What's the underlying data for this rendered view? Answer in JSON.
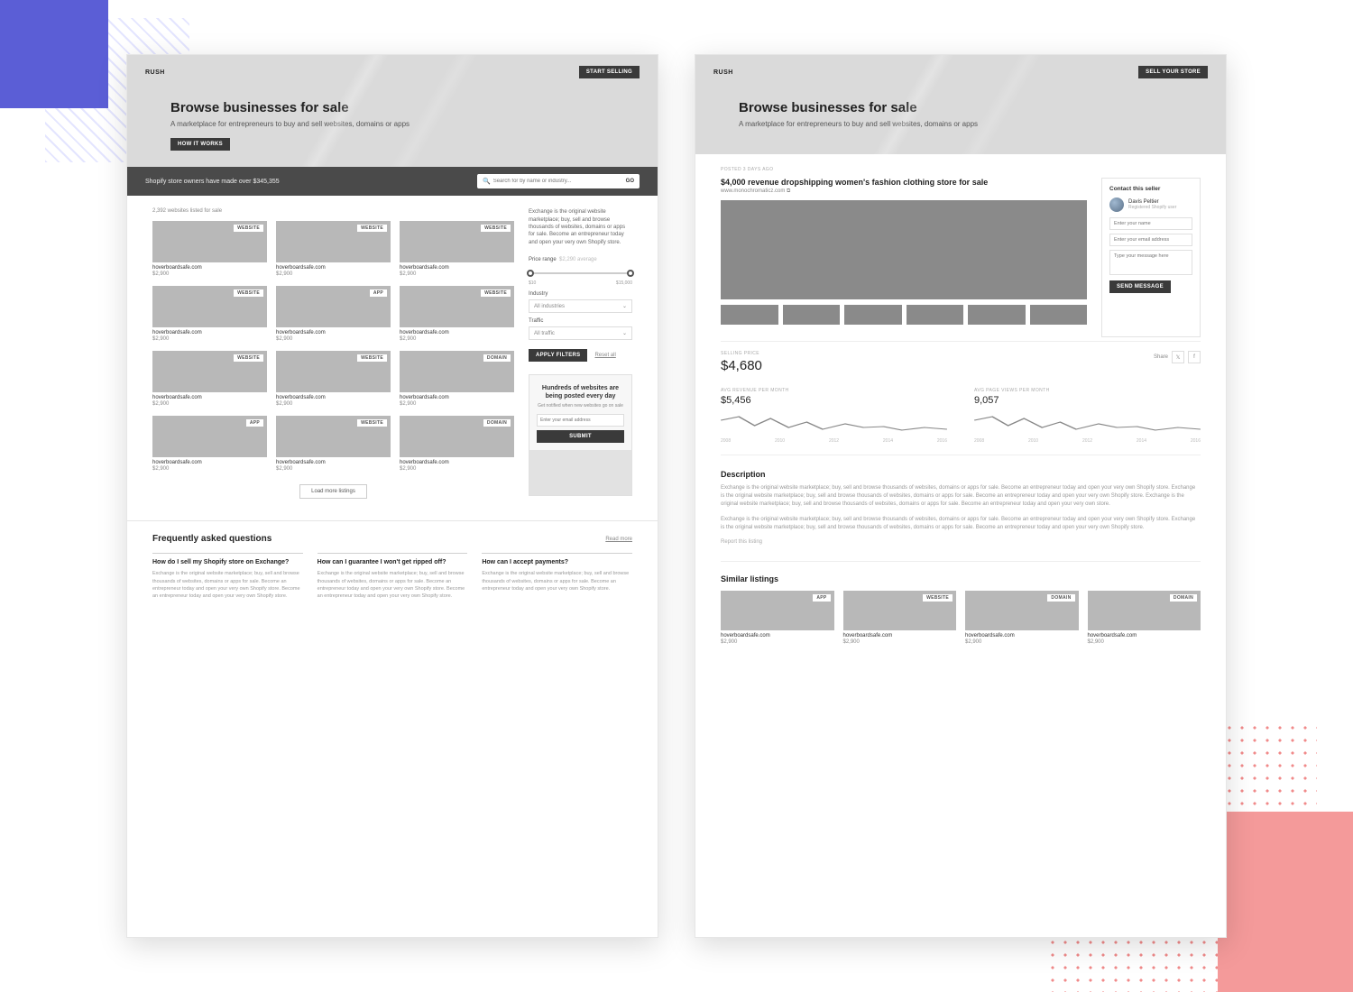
{
  "left": {
    "logo": "RUSH",
    "cta": "START SELLING",
    "hero_title": "Browse businesses for sale",
    "hero_sub": "A marketplace for entrepreneurs to buy and sell websites, domains or apps",
    "hero_btn": "HOW IT WORKS",
    "searchbar_tagline": "Shopify store owners have made over $345,355",
    "search_placeholder": "Search for by name or industry...",
    "search_go": "GO",
    "listings_count": "2,392 websites listed for sale",
    "cards": [
      {
        "tag": "WEBSITE",
        "title": "hoverboardsafe.com",
        "price": "$2,900"
      },
      {
        "tag": "WEBSITE",
        "title": "hoverboardsafe.com",
        "price": "$2,900"
      },
      {
        "tag": "WEBSITE",
        "title": "hoverboardsafe.com",
        "price": "$2,900"
      },
      {
        "tag": "WEBSITE",
        "title": "hoverboardsafe.com",
        "price": "$2,900"
      },
      {
        "tag": "APP",
        "title": "hoverboardsafe.com",
        "price": "$2,900"
      },
      {
        "tag": "WEBSITE",
        "title": "hoverboardsafe.com",
        "price": "$2,900"
      },
      {
        "tag": "WEBSITE",
        "title": "hoverboardsafe.com",
        "price": "$2,900"
      },
      {
        "tag": "WEBSITE",
        "title": "hoverboardsafe.com",
        "price": "$2,900"
      },
      {
        "tag": "DOMAIN",
        "title": "hoverboardsafe.com",
        "price": "$2,900"
      },
      {
        "tag": "APP",
        "title": "hoverboardsafe.com",
        "price": "$2,900"
      },
      {
        "tag": "WEBSITE",
        "title": "hoverboardsafe.com",
        "price": "$2,900"
      },
      {
        "tag": "DOMAIN",
        "title": "hoverboardsafe.com",
        "price": "$2,900"
      }
    ],
    "load_more": "Load more listings",
    "sidebar": {
      "intro": "Exchange is the original website marketplace; buy, sell and browse thousands of websites, domains or apps for sale. Become an entrepreneur today and open your very own Shopify store.",
      "price_label": "Price range",
      "price_avg": "$2,290 average",
      "price_min": "$10",
      "price_max": "$15,000",
      "industry_label": "Industry",
      "industry_value": "All industries",
      "traffic_label": "Traffic",
      "traffic_value": "All traffic",
      "apply": "APPLY FILTERS",
      "reset": "Reset all",
      "promo_title": "Hundreds of websites are being posted every day",
      "promo_sub": "Get notified when new websites go on sale",
      "promo_placeholder": "Enter your email address",
      "promo_submit": "SUBMIT"
    },
    "faq": {
      "heading": "Frequently asked questions",
      "link": "Read more",
      "items": [
        {
          "q": "How do I sell my Shopify store on Exchange?",
          "a": "Exchange is the original website marketplace; buy, sell and browse thousands of websites, domains or apps for sale. Become an entrepreneur today and open your very own Shopify store. Become an entrepreneur today and open your very own Shopify store."
        },
        {
          "q": "How can I guarantee I won't get ripped off?",
          "a": "Exchange is the original website marketplace; buy, sell and browse thousands of websites, domains or apps for sale. Become an entrepreneur today and open your very own Shopify store. Become an entrepreneur today and open your very own Shopify store."
        },
        {
          "q": "How can I accept payments?",
          "a": "Exchange is the original website marketplace; buy, sell and browse thousands of websites, domains or apps for sale. Become an entrepreneur today and open your very own Shopify store."
        }
      ]
    }
  },
  "right": {
    "logo": "RUSH",
    "cta": "SELL YOUR STORE",
    "hero_title": "Browse businesses for sale",
    "hero_sub": "A marketplace for entrepreneurs to buy and sell websites, domains or apps",
    "posted": "POSTED 3 DAYS AGO",
    "listing_title": "$4,000 revenue dropshipping women's fashion clothing store for sale",
    "listing_url": "www.monochromaticz.com ⧉",
    "contact": {
      "heading": "Contact this seller",
      "seller_name": "Davis Peltier",
      "seller_sub": "Registered Shopify user",
      "name_ph": "Enter your name",
      "email_ph": "Enter your email address",
      "msg_ph": "Type your message here",
      "send": "SEND MESSAGE"
    },
    "price_label": "SELLING PRICE",
    "price": "$4,680",
    "share_label": "Share",
    "stats": [
      {
        "label": "AVG REVENUE PER MONTH",
        "value": "$5,456",
        "years": [
          "2008",
          "2010",
          "2012",
          "2014",
          "2016"
        ]
      },
      {
        "label": "AVG PAGE VIEWS PER MONTH",
        "value": "9,057",
        "years": [
          "2008",
          "2010",
          "2012",
          "2014",
          "2016"
        ]
      }
    ],
    "desc_heading": "Description",
    "desc_p1": "Exchange is the original website marketplace; buy, sell and browse thousands of websites, domains or apps for sale. Become an entrepreneur today and open your very own Shopify store. Exchange is the original website marketplace; buy, sell and browse thousands of websites, domains or apps for sale. Become an entrepreneur today and open your very own Shopify store. Exchange is the original website marketplace; buy, sell and browse thousands of websites, domains or apps for sale. Become an entrepreneur today and open your very own store.",
    "desc_p2": "Exchange is the original website marketplace; buy, sell and browse thousands of websites, domains or apps for sale. Become an entrepreneur today and open your very own Shopify store. Exchange is the original website marketplace; buy, sell and browse thousands of websites, domains or apps for sale. Become an entrepreneur today and open your very own Shopify store.",
    "report": "Report this listing",
    "similar_heading": "Similar listings",
    "similar": [
      {
        "tag": "APP",
        "title": "hoverboardsafe.com",
        "price": "$2,900"
      },
      {
        "tag": "WEBSITE",
        "title": "hoverboardsafe.com",
        "price": "$2,900"
      },
      {
        "tag": "DOMAIN",
        "title": "hoverboardsafe.com",
        "price": "$2,900"
      },
      {
        "tag": "DOMAIN",
        "title": "hoverboardsafe.com",
        "price": "$2,900"
      }
    ]
  }
}
